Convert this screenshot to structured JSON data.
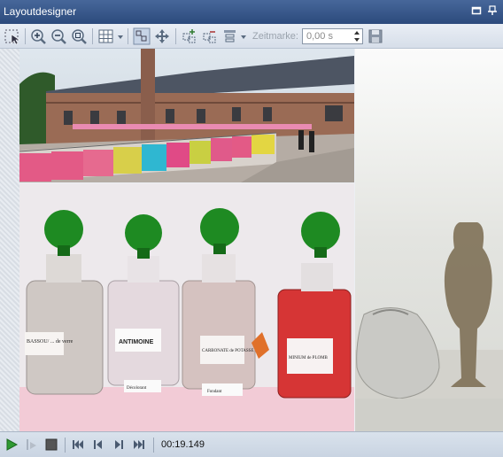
{
  "window": {
    "title": "Layoutdesigner"
  },
  "toolbar": {
    "zeitmarke_label": "Zeitmarke:",
    "zeitmarke_value": "0,00 s"
  },
  "canvas": {
    "label_antimoine": "ANTIMOINE",
    "label_carbonate": "CARBONATE de POTASSE",
    "label_minium": "MINIUM de PLOMB",
    "label_bassou": "BASSOU/ ... de verre",
    "label_fondant": "Fondant",
    "label_decolorant": "Décolorant"
  },
  "player": {
    "timecode": "00:19.149"
  },
  "colors": {
    "title_bar": "#3a5a8c",
    "toolbar": "#dfe6ef"
  }
}
